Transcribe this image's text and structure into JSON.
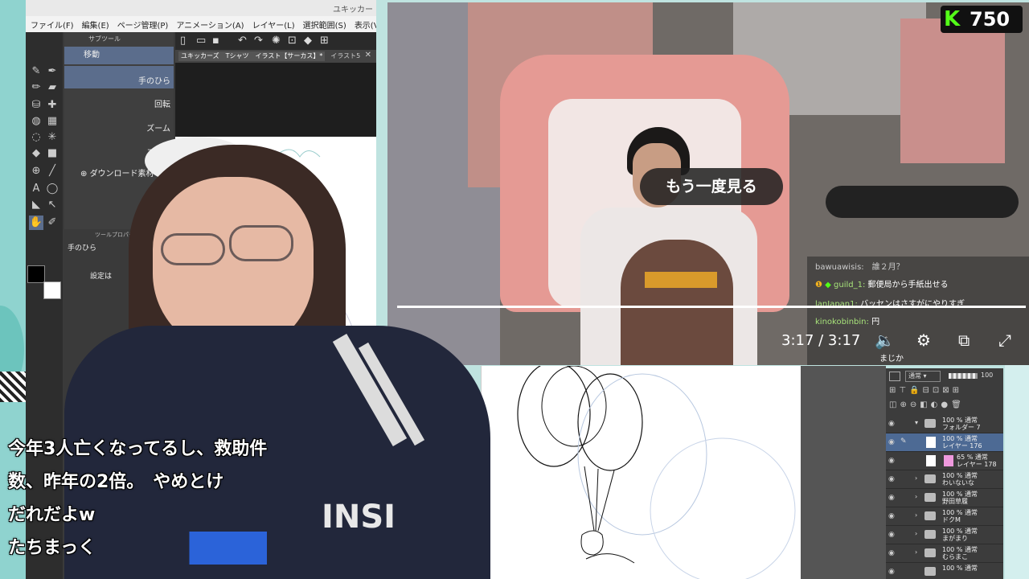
{
  "app": {
    "title": "ユキッカー",
    "menu": [
      "ファイル(F)",
      "編集(E)",
      "ページ管理(P)",
      "アニメーション(A)",
      "レイヤー(L)",
      "選択範囲(S)",
      "表示(V)"
    ],
    "subtool_header": "サブツール",
    "subtools": [
      "移動",
      "手のひら",
      "回転",
      "ズーム",
      "ズーム"
    ],
    "download_label": "ダウンロード素材",
    "tool_property_header": "ツールプロパティ",
    "tool_property_name": "手のひら",
    "settings_label": "設定は",
    "tabs": [
      "ユキッカーズ　Tシャツ　イラスト【サーカス】*",
      "イラスト5"
    ]
  },
  "video": {
    "kick_count": "750",
    "replay_label": "もう一度見る",
    "time": "3:17 / 3:17",
    "chat": [
      {
        "user": "",
        "text": "bawuawisis:　誰２月？"
      },
      {
        "user": "guild_1:",
        "text": "郵便局から手紙出せる"
      },
      {
        "user": "lanJapan1:",
        "text": "バッセンはさすがにやりすぎ"
      },
      {
        "user": "kinokobinbin:",
        "text": "円"
      },
      {
        "user": "",
        "text": "バ"
      },
      {
        "user": "",
        "text": "まじか"
      }
    ]
  },
  "layers": {
    "blend_mode": "通常",
    "opacity": "100",
    "rows": [
      {
        "line1": "100 % 通常",
        "line2": "フォルダー 7",
        "selected": false
      },
      {
        "line1": "100 % 通常",
        "line2": "レイヤー 176",
        "selected": true
      },
      {
        "line1": "65 % 通常",
        "line2": "レイヤー 178",
        "selected": false
      },
      {
        "line1": "100 % 通常",
        "line2": "わいないな",
        "selected": false
      },
      {
        "line1": "100 % 通常",
        "line2": "野田草履",
        "selected": false
      },
      {
        "line1": "100 % 通常",
        "line2": "ドクM",
        "selected": false
      },
      {
        "line1": "100 % 通常",
        "line2": "まがまり",
        "selected": false
      },
      {
        "line1": "100 % 通常",
        "line2": "むらまこ",
        "selected": false
      },
      {
        "line1": "100 % 通常",
        "line2": "",
        "selected": false
      }
    ]
  },
  "overlay": {
    "shirt_logo": "INSI",
    "subtitles": [
      "今年3人亡くなってるし、救助件",
      "数、昨年の2倍。　やめとけ",
      "だれだよw",
      "たちまっく"
    ]
  }
}
